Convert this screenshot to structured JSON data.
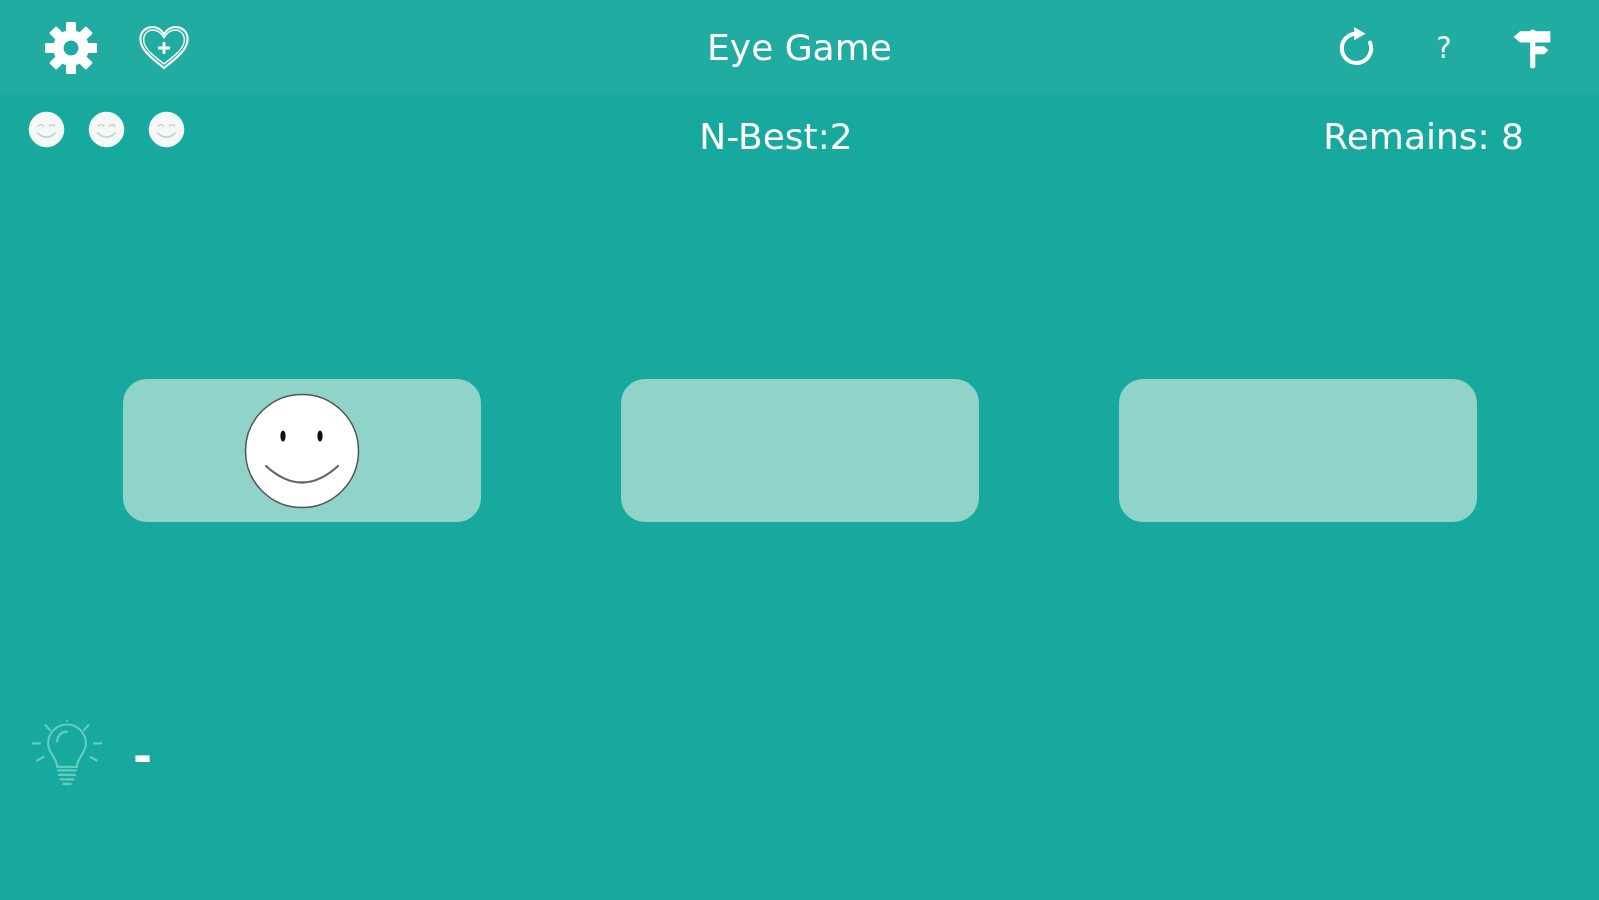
{
  "top_bar": {
    "title": "Eye Game",
    "help": "?"
  },
  "stats": {
    "lives": [
      {
        "lost": false
      },
      {
        "lost": false
      },
      {
        "lost": false
      }
    ],
    "best": "N-Best:2",
    "remains": "Remains: 8"
  },
  "cards": [
    {
      "revealed": true
    },
    {
      "revealed": false
    },
    {
      "revealed": false
    }
  ],
  "hint": {
    "disabled": true,
    "count": "-"
  }
}
